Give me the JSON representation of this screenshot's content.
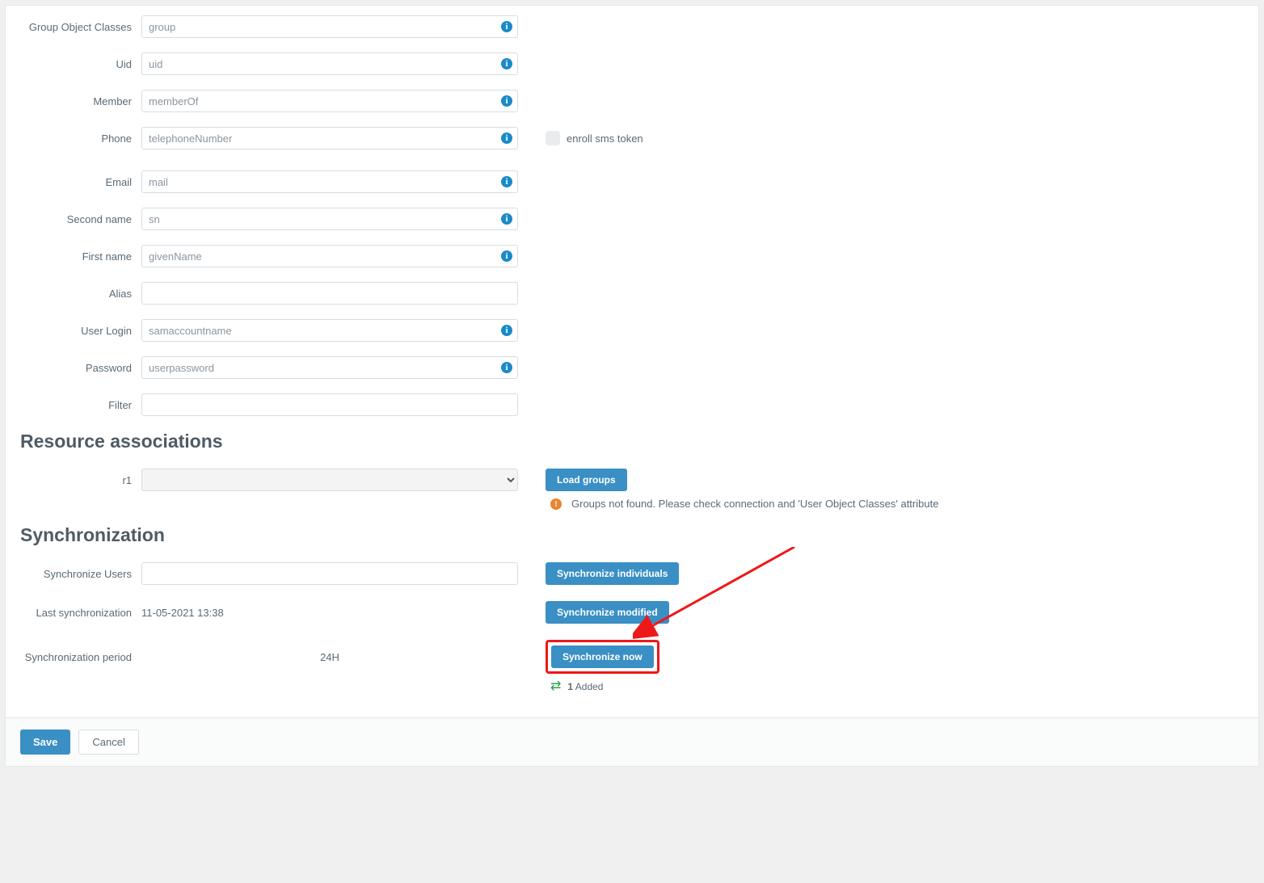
{
  "fields": {
    "group_object_classes": {
      "label": "Group Object Classes",
      "value": "group"
    },
    "uid": {
      "label": "Uid",
      "value": "uid"
    },
    "member": {
      "label": "Member",
      "value": "memberOf"
    },
    "phone": {
      "label": "Phone",
      "value": "telephoneNumber"
    },
    "email": {
      "label": "Email",
      "value": "mail"
    },
    "second": {
      "label": "Second name",
      "value": "sn"
    },
    "first": {
      "label": "First name",
      "value": "givenName"
    },
    "alias": {
      "label": "Alias",
      "value": ""
    },
    "userlogin": {
      "label": "User Login",
      "value": "samaccountname"
    },
    "password": {
      "label": "Password",
      "value": "userpassword"
    },
    "filter": {
      "label": "Filter",
      "value": ""
    }
  },
  "phone_checkbox_label": "enroll sms token",
  "sections": {
    "resource": "Resource associations",
    "sync": "Synchronization"
  },
  "resource": {
    "r1_label": "r1",
    "load_groups": "Load groups",
    "warning": "Groups not found. Please check connection and 'User Object Classes' attribute"
  },
  "sync": {
    "users_label": "Synchronize Users",
    "users_value": "",
    "individuals_btn": "Synchronize individuals",
    "last_label": "Last synchronization",
    "last_value": "11-05-2021 13:38",
    "modified_btn": "Synchronize modified",
    "period_label": "Synchronization period",
    "period_value": "24H",
    "now_btn": "Synchronize now",
    "added_count": "1",
    "added_text": "Added"
  },
  "footer": {
    "save": "Save",
    "cancel": "Cancel"
  }
}
